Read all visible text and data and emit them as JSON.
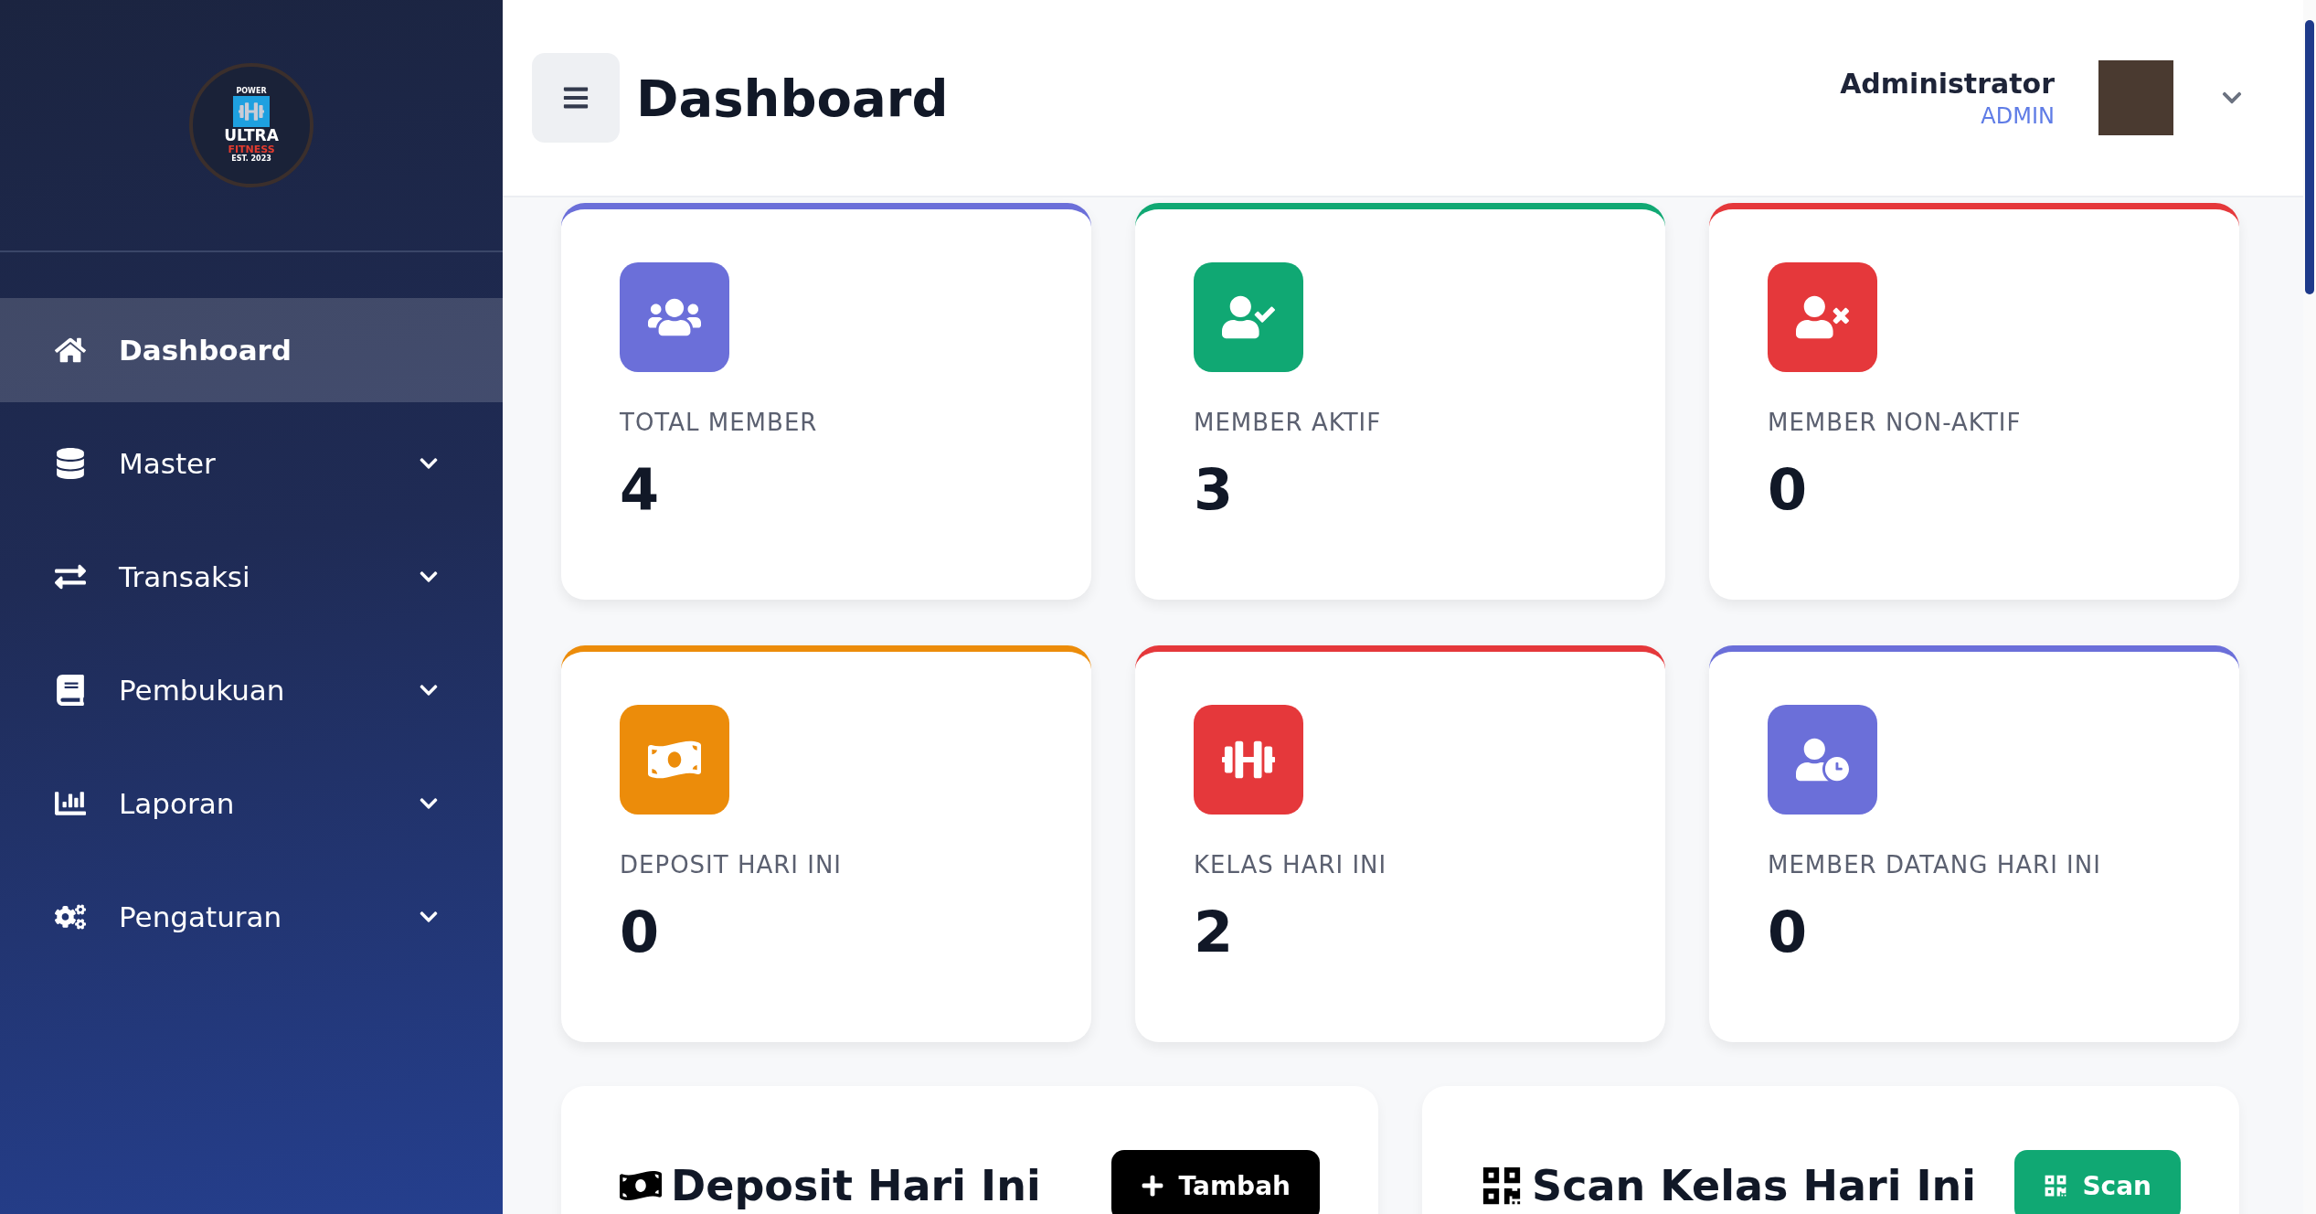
{
  "sidebar": {
    "logo": {
      "top": "POWER",
      "name": "ULTRA",
      "sub": "FITNESS",
      "est": "EST. 2023"
    },
    "items": [
      {
        "label": "Dashboard",
        "kind": "home",
        "selected": true,
        "expandable": false
      },
      {
        "label": "Master",
        "kind": "database",
        "selected": false,
        "expandable": true
      },
      {
        "label": "Transaksi",
        "kind": "exchange",
        "selected": false,
        "expandable": true
      },
      {
        "label": "Pembukuan",
        "kind": "book",
        "selected": false,
        "expandable": true
      },
      {
        "label": "Laporan",
        "kind": "chart",
        "selected": false,
        "expandable": true
      },
      {
        "label": "Pengaturan",
        "kind": "cogs",
        "selected": false,
        "expandable": true
      }
    ]
  },
  "header": {
    "title": "Dashboard",
    "user": {
      "name": "Administrator",
      "role": "ADMIN"
    }
  },
  "stats": [
    {
      "label": "TOTAL MEMBER",
      "value": "4",
      "kind": "users",
      "color": "#6b6fd9"
    },
    {
      "label": "MEMBER AKTIF",
      "value": "3",
      "kind": "user-check",
      "color": "#10a873"
    },
    {
      "label": "MEMBER NON-AKTIF",
      "value": "0",
      "kind": "user-times",
      "color": "#e5383b"
    },
    {
      "label": "DEPOSIT HARI INI",
      "value": "0",
      "kind": "money",
      "color": "#ec8c0a"
    },
    {
      "label": "KELAS HARI INI",
      "value": "2",
      "kind": "dumbbell",
      "color": "#e5383b"
    },
    {
      "label": "MEMBER DATANG HARI INI",
      "value": "0",
      "kind": "user-clock",
      "color": "#6b6fd9"
    }
  ],
  "panels": [
    {
      "title": "Deposit Hari Ini",
      "kind": "money",
      "button": {
        "label": "Tambah",
        "kind": "add"
      }
    },
    {
      "title": "Scan Kelas Hari Ini",
      "kind": "qr",
      "button": {
        "label": "Scan",
        "kind": "scan"
      }
    }
  ]
}
